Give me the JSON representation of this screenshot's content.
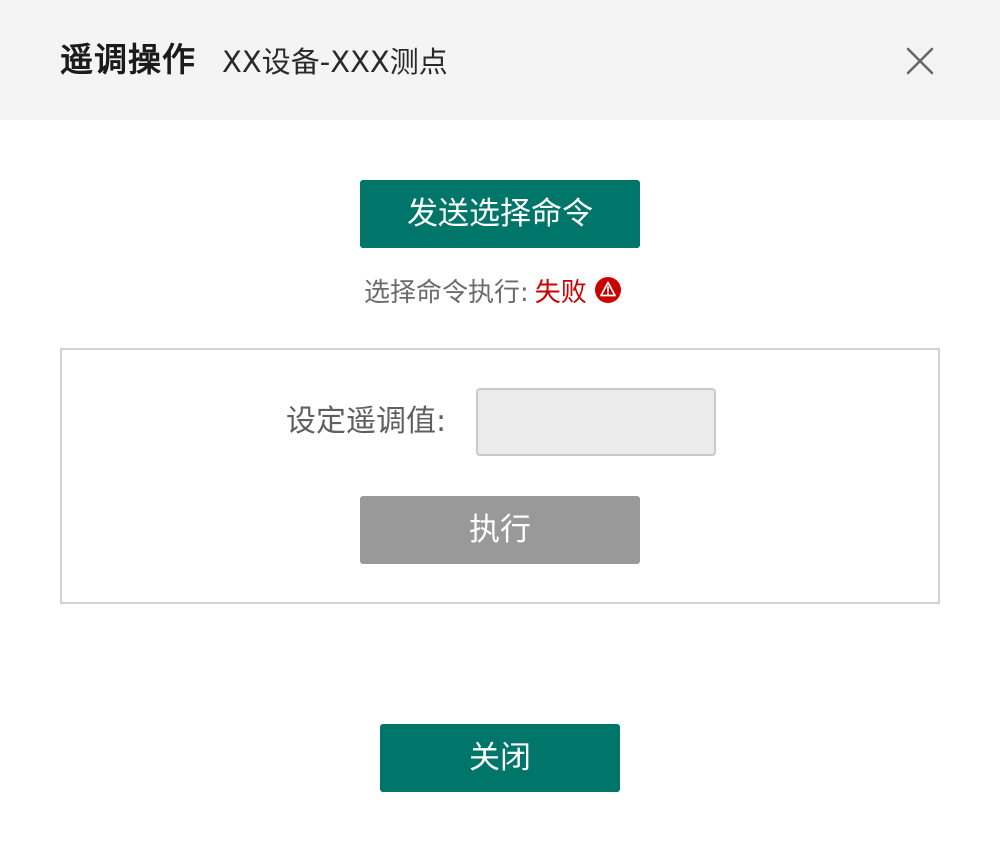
{
  "dialog": {
    "title": "遥调操作",
    "subtitle": "XX设备-XXX测点"
  },
  "select_command": {
    "button_label": "发送选择命令",
    "status_label": "选择命令执行:",
    "status_value": "失败",
    "status_color": "#cc0000",
    "status_icon": "warning-icon"
  },
  "setpoint": {
    "label": "设定遥调值:",
    "value": "",
    "execute_label": "执行"
  },
  "footer": {
    "close_label": "关闭"
  },
  "colors": {
    "primary": "#00766a",
    "disabled": "#999999",
    "header_bg": "#f3f4f3"
  }
}
